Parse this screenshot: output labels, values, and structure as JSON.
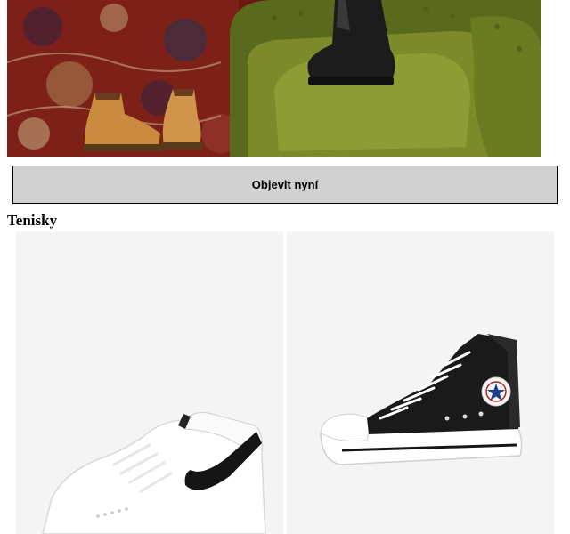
{
  "hero": {
    "image": "boots-on-rug-and-green-leather-armchair"
  },
  "cta": {
    "label": "Objevit nyní"
  },
  "section": {
    "title": "Tenisky"
  },
  "products": [
    {
      "image": "white-sneaker-black-swoosh"
    },
    {
      "image": "black-high-top-canvas-sneaker"
    }
  ],
  "colors": {
    "button_bg": "#d1d1d1",
    "card_bg": "#f4f4f4"
  }
}
